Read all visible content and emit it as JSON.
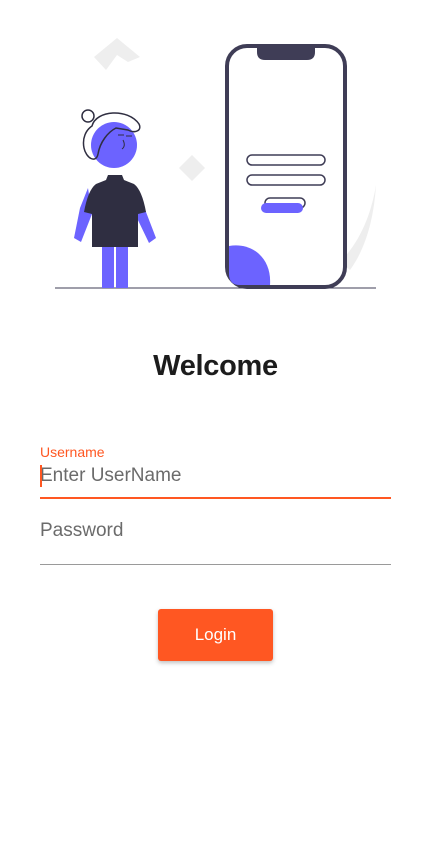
{
  "screen": {
    "title": "Welcome"
  },
  "form": {
    "username": {
      "label": "Username",
      "placeholder": "Enter UserName",
      "value": ""
    },
    "password": {
      "placeholder": "Password",
      "value": ""
    },
    "login_label": "Login"
  },
  "illustration": {
    "icon": "person-with-phone-login-illustration"
  },
  "colors": {
    "accent": "#ff5722",
    "illustration_primary": "#6c63ff",
    "illustration_dark": "#3f3d56",
    "text": "#1c1c1c"
  }
}
